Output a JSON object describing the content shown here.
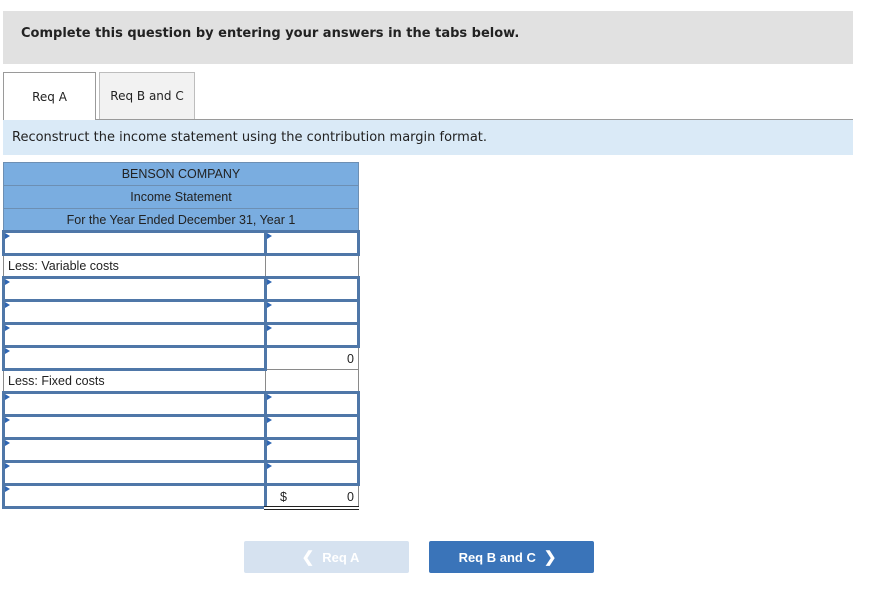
{
  "instruction": "Complete this question by entering your answers in the tabs below.",
  "tabs": [
    {
      "label": "Req A",
      "active": true
    },
    {
      "label": "Req B and C",
      "active": false
    }
  ],
  "prompt": "Reconstruct the income statement using the contribution margin format.",
  "statement": {
    "company": "BENSON COMPANY",
    "title": "Income Statement",
    "period": "For the Year Ended December 31, Year 1",
    "variable_costs_label": "Less: Variable costs",
    "fixed_costs_label": "Less: Fixed costs",
    "contribution_margin_value": "0",
    "net_income_currency": "$",
    "net_income_value": "0"
  },
  "nav": {
    "prev_label": "Req A",
    "next_label": "Req B and C",
    "prev_icon": "chevron-left-icon",
    "next_icon": "chevron-right-icon"
  }
}
